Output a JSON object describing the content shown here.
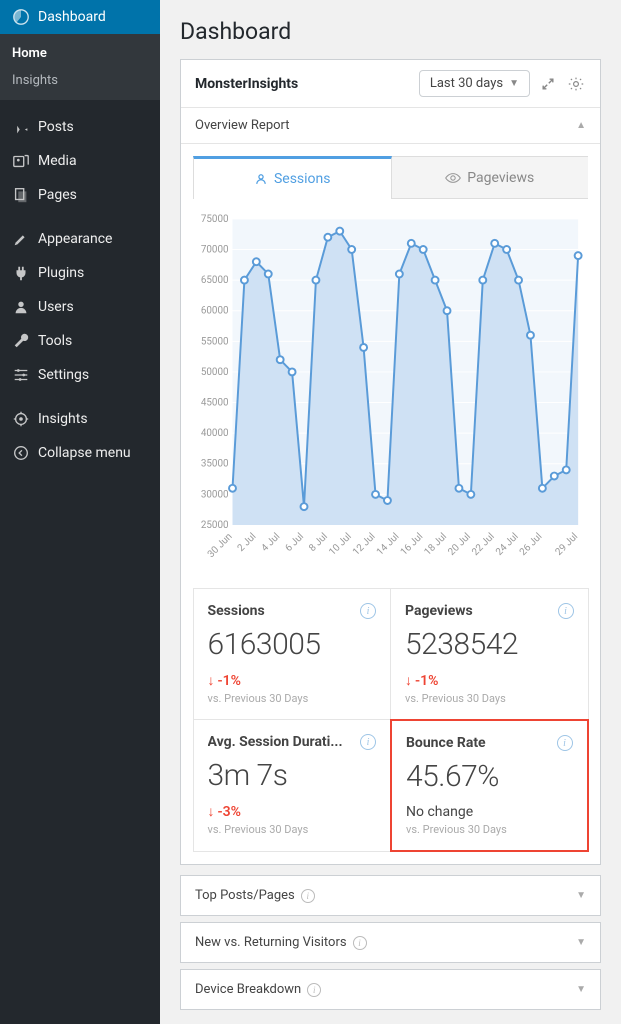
{
  "sidebar": {
    "items": [
      {
        "label": "Dashboard",
        "icon": "dashboard"
      },
      {
        "label": "Posts",
        "icon": "pin"
      },
      {
        "label": "Media",
        "icon": "media"
      },
      {
        "label": "Pages",
        "icon": "pages"
      },
      {
        "label": "Appearance",
        "icon": "brush"
      },
      {
        "label": "Plugins",
        "icon": "plug"
      },
      {
        "label": "Users",
        "icon": "user"
      },
      {
        "label": "Tools",
        "icon": "wrench"
      },
      {
        "label": "Settings",
        "icon": "sliders"
      },
      {
        "label": "Insights",
        "icon": "insights"
      },
      {
        "label": "Collapse menu",
        "icon": "collapse"
      }
    ],
    "sub": [
      "Home",
      "Insights"
    ]
  },
  "page": {
    "title": "Dashboard"
  },
  "panel": {
    "title": "MonsterInsights",
    "date_label": "Last 30 days",
    "section_title": "Overview Report"
  },
  "tabs": {
    "sessions": "Sessions",
    "pageviews": "Pageviews"
  },
  "chart_data": {
    "type": "line",
    "title": "",
    "xlabel": "",
    "ylabel": "",
    "ylim": [
      25000,
      75000
    ],
    "y_ticks": [
      25000,
      30000,
      35000,
      40000,
      45000,
      50000,
      55000,
      60000,
      65000,
      70000,
      75000
    ],
    "x_ticks": [
      "30 Jun",
      "2 Jul",
      "4 Jul",
      "6 Jul",
      "8 Jul",
      "10 Jul",
      "12 Jul",
      "14 Jul",
      "16 Jul",
      "18 Jul",
      "20 Jul",
      "22 Jul",
      "24 Jul",
      "26 Jul",
      "29 Jul"
    ],
    "categories": [
      "30 Jun",
      "1 Jul",
      "2 Jul",
      "3 Jul",
      "4 Jul",
      "5 Jul",
      "6 Jul",
      "7 Jul",
      "8 Jul",
      "9 Jul",
      "10 Jul",
      "11 Jul",
      "12 Jul",
      "13 Jul",
      "14 Jul",
      "15 Jul",
      "16 Jul",
      "17 Jul",
      "18 Jul",
      "19 Jul",
      "20 Jul",
      "21 Jul",
      "22 Jul",
      "23 Jul",
      "24 Jul",
      "25 Jul",
      "26 Jul",
      "27 Jul",
      "28 Jul",
      "29 Jul"
    ],
    "series": [
      {
        "name": "Sessions",
        "values": [
          31000,
          65000,
          68000,
          66000,
          52000,
          50000,
          28000,
          65000,
          72000,
          73000,
          70000,
          54000,
          30000,
          29000,
          66000,
          71000,
          70000,
          65000,
          60000,
          31000,
          30000,
          65000,
          71000,
          70000,
          65000,
          56000,
          31000,
          33000,
          34000,
          69000
        ]
      }
    ]
  },
  "stats": [
    {
      "title": "Sessions",
      "value": "6163005",
      "change": "-1%",
      "direction": "down",
      "compare": "vs. Previous 30 Days"
    },
    {
      "title": "Pageviews",
      "value": "5238542",
      "change": "-1%",
      "direction": "down",
      "compare": "vs. Previous 30 Days"
    },
    {
      "title": "Avg. Session Durati...",
      "value": "3m 7s",
      "change": "-3%",
      "direction": "down",
      "compare": "vs. Previous 30 Days"
    },
    {
      "title": "Bounce Rate",
      "value": "45.67%",
      "change": "No change",
      "direction": "none",
      "compare": "vs. Previous 30 Days",
      "highlighted": true
    }
  ],
  "collapsed": [
    "Top Posts/Pages",
    "New vs. Returning Visitors",
    "Device Breakdown"
  ]
}
